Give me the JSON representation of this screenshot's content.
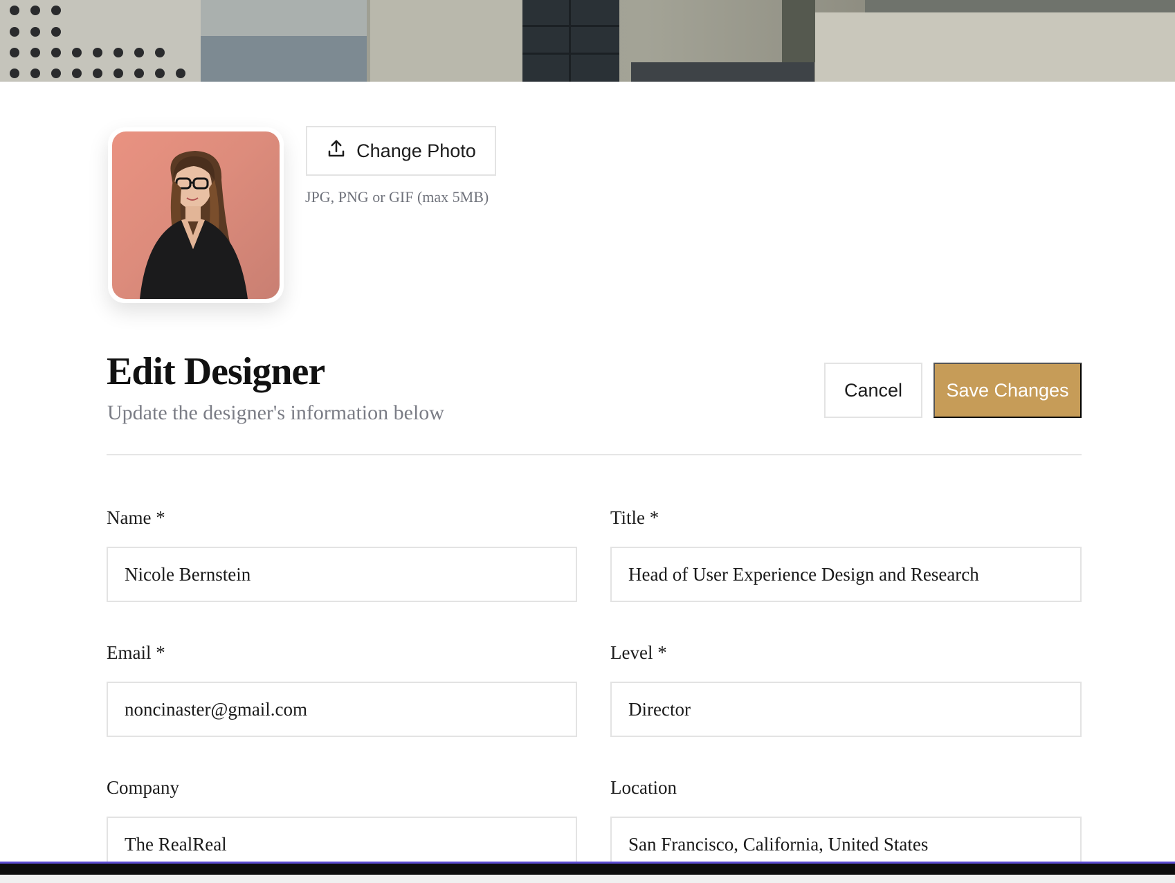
{
  "photo": {
    "change_label": "Change Photo",
    "hint": "JPG, PNG or GIF (max 5MB)",
    "upload_icon": "upload-icon"
  },
  "header": {
    "title": "Edit Designer",
    "subtitle": "Update the designer's information below",
    "cancel_label": "Cancel",
    "save_label": "Save Changes"
  },
  "form": {
    "name": {
      "label": "Name *",
      "value": "Nicole Bernstein"
    },
    "title": {
      "label": "Title *",
      "value": "Head of User Experience Design and Research"
    },
    "email": {
      "label": "Email *",
      "value": "noncinaster@gmail.com"
    },
    "level": {
      "label": "Level *",
      "value": "Director"
    },
    "company": {
      "label": "Company",
      "value": "The RealReal"
    },
    "location": {
      "label": "Location",
      "value": "San Francisco, California, United States"
    }
  },
  "colors": {
    "accent": "#c69c58",
    "muted_text": "#7a7c85",
    "border": "#e3e3e3"
  }
}
